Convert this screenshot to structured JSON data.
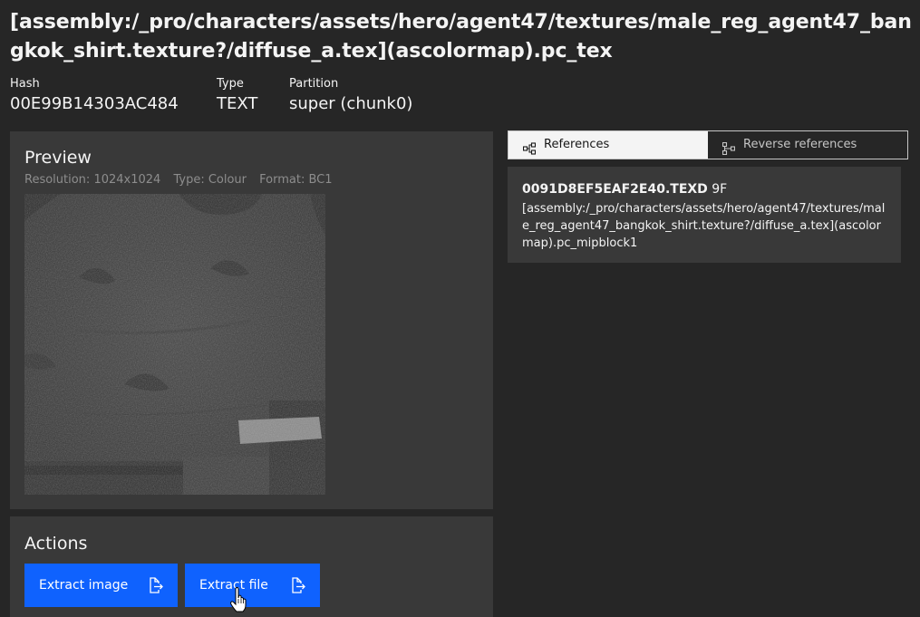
{
  "header": {
    "title": "[assembly:/_pro/characters/assets/hero/agent47/textures/male_reg_agent47_bangkok_shirt.texture?/diffuse_a.tex](ascolormap).pc_tex",
    "hash_label": "Hash",
    "hash_value": "00E99B14303AC484",
    "type_label": "Type",
    "type_value": "TEXT",
    "partition_label": "Partition",
    "partition_value": "super (chunk0)"
  },
  "preview": {
    "title": "Preview",
    "resolution": "Resolution: 1024x1024",
    "type": "Type: Colour",
    "format": "Format: BC1"
  },
  "actions": {
    "title": "Actions",
    "extract_image_label": "Extract image",
    "extract_file_label": "Extract file"
  },
  "tabs": {
    "references_label": "References",
    "reverse_label": "Reverse references"
  },
  "references": [
    {
      "hash": "0091D8EF5EAF2E40.TEXD",
      "flag": "9F",
      "path": "[assembly:/_pro/characters/assets/hero/agent47/textures/male_reg_agent47_bangkok_shirt.texture?/diffuse_a.tex](ascolormap).pc_mipblock1"
    }
  ],
  "colors": {
    "background": "#262626",
    "panel": "#393939",
    "primary_button": "#0f62fe",
    "tab_selected": "#f4f4f4",
    "muted_text": "#8d8d8d"
  },
  "icons": {
    "export": "export-icon",
    "references": "tree-view-icon",
    "reverse_references": "tree-view-alt-icon",
    "cursor": "hand-pointer-icon"
  }
}
